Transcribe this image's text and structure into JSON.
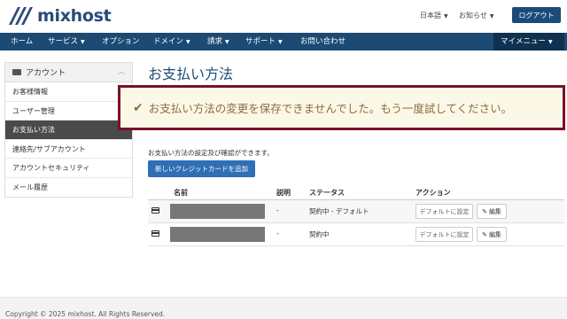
{
  "header": {
    "logo_text": "mixhost",
    "language": "日本語",
    "notices": "お知らせ",
    "logout": "ログアウト"
  },
  "nav": {
    "items": [
      {
        "label": "ホーム",
        "caret": ""
      },
      {
        "label": "サービス",
        "caret": "▼"
      },
      {
        "label": "オプション",
        "caret": ""
      },
      {
        "label": "ドメイン",
        "caret": "▼"
      },
      {
        "label": "請求",
        "caret": "▼"
      },
      {
        "label": "サポート",
        "caret": "▼"
      },
      {
        "label": "お問い合わせ",
        "caret": ""
      }
    ],
    "my_menu": "マイメニュー",
    "my_menu_caret": "▼"
  },
  "sidebar": {
    "title": "アカウント",
    "items": [
      {
        "label": "お客様情報"
      },
      {
        "label": "ユーザー管理"
      },
      {
        "label": "お支払い方法"
      },
      {
        "label": "連絡先/サブアカウント"
      },
      {
        "label": "アカウントセキュリティ"
      },
      {
        "label": "メール履歴"
      }
    ]
  },
  "main": {
    "title": "お支払い方法",
    "alert": "お支払い方法の変更を保存できませんでした。もう一度試してください。",
    "intro": "お支払い方法の設定及び確認ができます。",
    "add_button": "新しいクレジットカードを追加",
    "columns": {
      "name": "名前",
      "description": "説明",
      "status": "ステータス",
      "action": "アクション"
    },
    "rows": [
      {
        "description": "-",
        "status": "契約中 - デフォルト",
        "default_button": "デフォルトに設定",
        "edit_button": "編集"
      },
      {
        "description": "-",
        "status": "契約中",
        "default_button": "デフォルトに設定",
        "edit_button": "編集"
      }
    ]
  },
  "footer": {
    "copyright": "Copyright © 2025 mixhost. All Rights Reserved."
  },
  "colors": {
    "nav_bg": "#1c4a73",
    "alert_border": "#7a1028",
    "alert_bg": "#fcf8e8",
    "primary_button": "#2f6fb5"
  }
}
